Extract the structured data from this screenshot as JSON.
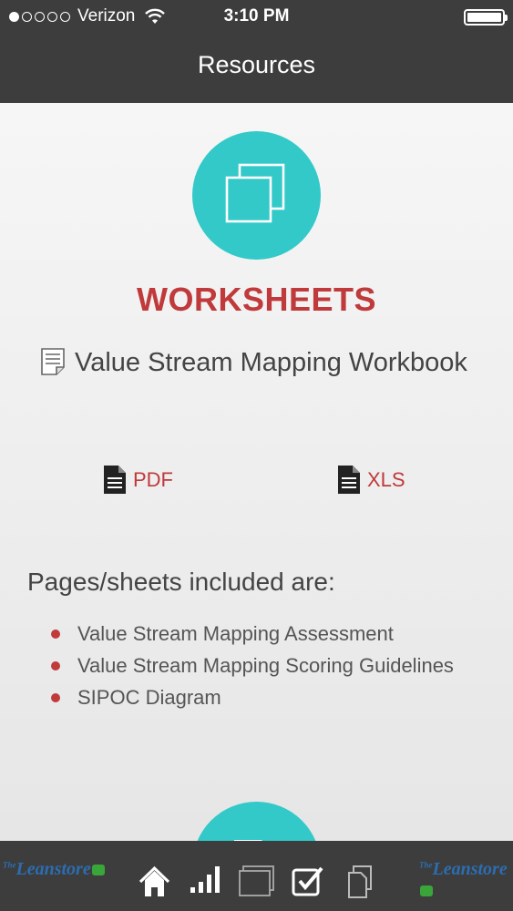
{
  "status_bar": {
    "carrier": "Verizon",
    "time": "3:10 PM",
    "signal_dots": [
      true,
      false,
      false,
      false,
      false
    ]
  },
  "nav": {
    "title": "Resources"
  },
  "section": {
    "heading": "WORKSHEETS",
    "item_title": "Value Stream Mapping Workbook",
    "downloads": {
      "pdf": "PDF",
      "xls": "XLS"
    },
    "pages_label": "Pages/sheets included are:",
    "pages": [
      "Value Stream Mapping Assessment",
      "Value Stream Mapping Scoring Guidelines",
      "SIPOC Diagram"
    ]
  },
  "tabbar": {
    "brand": {
      "prefix": "The",
      "name": "Leanstore"
    },
    "tabs": [
      "home-icon",
      "chart-icon",
      "resources-icon",
      "checklist-icon",
      "documents-icon"
    ]
  },
  "colors": {
    "accent": "#c0393b",
    "teal": "#33c9c9",
    "dark": "#3d3d3d"
  }
}
